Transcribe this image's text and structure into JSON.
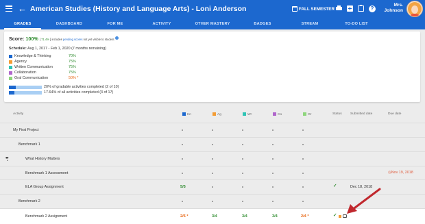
{
  "header": {
    "title": "American Studies (History and Language Arts) - Loni Anderson",
    "semester": "FALL SEMESTER",
    "user_name_line1": "Mrs.",
    "user_name_line2": "Johnson",
    "help_glyph": "?"
  },
  "tabs": [
    {
      "label": "GRADES",
      "active": true
    },
    {
      "label": "DASHBOARD"
    },
    {
      "label": "FOR ME"
    },
    {
      "label": "ACTIVITY"
    },
    {
      "label": "OTHER MASTERY"
    },
    {
      "label": "BADGES"
    },
    {
      "label": "STREAM"
    },
    {
      "label": "TO-DO LIST"
    }
  ],
  "score": {
    "label": "Score:",
    "value": "100%",
    "pending_value": "71.4%",
    "pending_text": "includes",
    "pending_link": "pending scores",
    "pending_tail": "not yet visible to student"
  },
  "schedule": {
    "label": "Schedule:",
    "text": "Aug 1, 2017 - Feb 1, 2020 (7 months remaining)"
  },
  "standards": [
    {
      "name": "Knowledge & Thinking",
      "value": "70%",
      "color": "#1c68cf",
      "status": "green"
    },
    {
      "name": "Agency",
      "value": "75%",
      "color": "#f39c33",
      "status": "green"
    },
    {
      "name": "Written Communication",
      "value": "75%",
      "color": "#2fc4b5",
      "status": "green"
    },
    {
      "name": "Collaboration",
      "value": "75%",
      "color": "#b066cc",
      "status": "green"
    },
    {
      "name": "Oral Communication",
      "value": "50% *",
      "color": "#8ed67c",
      "status": "orange"
    }
  ],
  "progress": [
    {
      "text": "20% of gradable activities completed (2 of 10)",
      "fraction": 0.2
    },
    {
      "text": "17.64% of all activities completed (3 of 17)",
      "fraction": 0.1764
    }
  ],
  "table": {
    "headers": {
      "activity": "Activity",
      "kn": "Kn",
      "ag": "Ag",
      "wr": "Wr",
      "co": "Co",
      "or": "Or",
      "status": "Status",
      "submitted": "Submitted date",
      "due": "Due date"
    },
    "rows": [
      {
        "name": "My First Project",
        "score_kn": "",
        "score_ag": "",
        "score_wr": "",
        "score_co": "",
        "score_or": "",
        "status": "",
        "submitted": "",
        "due": ""
      },
      {
        "name": "Benchmark 1",
        "score_kn": "",
        "score_ag": "",
        "score_wr": "",
        "score_co": "",
        "score_or": "",
        "status": "",
        "submitted": "",
        "due": ""
      },
      {
        "name": "What History Matters",
        "score_kn": "",
        "score_ag": "",
        "score_wr": "",
        "score_co": "",
        "score_or": "",
        "status": "",
        "submitted": "",
        "due": ""
      },
      {
        "name": "Benchmark 1 Assessment",
        "score_kn": "",
        "score_ag": "",
        "score_wr": "",
        "score_co": "",
        "score_or": "",
        "status": "",
        "submitted": "",
        "due": "Nov 19, 2018"
      },
      {
        "name": "ELA Group Assignment",
        "score_kn": "5/5",
        "score_ag": "",
        "score_wr": "",
        "score_co": "",
        "score_or": "",
        "status": "✓",
        "submitted": "Dec 18, 2018",
        "due": ""
      },
      {
        "name": "Benchmark 2",
        "score_kn": "",
        "score_ag": "",
        "score_wr": "",
        "score_co": "",
        "score_or": "",
        "status": "",
        "submitted": "",
        "due": ""
      },
      {
        "name": "Benchmark 2 Assignment",
        "score_kn": "2/5 *",
        "score_ag": "3/4",
        "score_wr": "3/4",
        "score_co": "3/4",
        "score_or": "2/4 *",
        "status": "✓",
        "submitted": "",
        "due": ""
      }
    ]
  },
  "colors": {
    "brand": "#1c68cf",
    "good": "#2e8b2e",
    "warning": "#e8620c",
    "overdue": "#e05a3b",
    "arrow": "#c0282e"
  },
  "icons": [
    "menu-icon",
    "back-arrow-icon",
    "calendar-icon",
    "print-icon",
    "add-icon",
    "clipboard-icon",
    "help-icon",
    "clock-icon",
    "comment-icon",
    "drag-handle-icon"
  ]
}
